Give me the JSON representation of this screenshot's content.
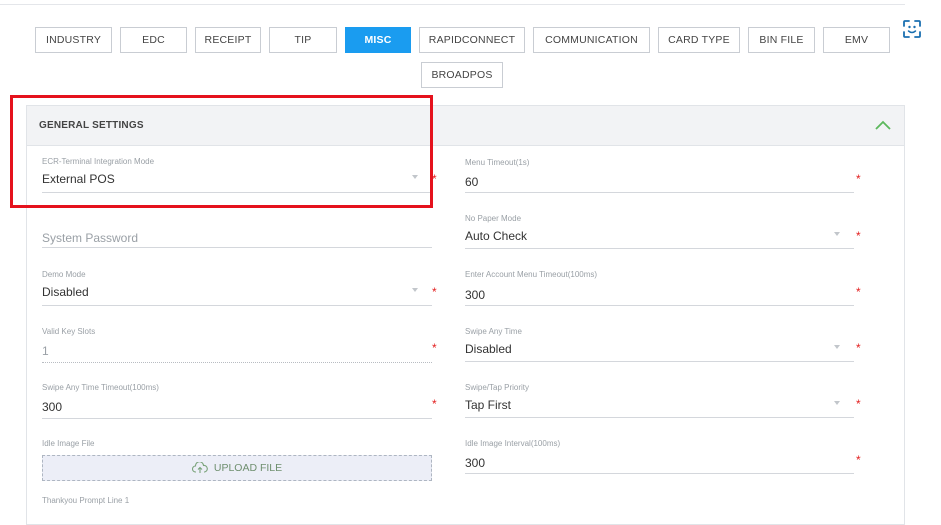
{
  "tabs": [
    {
      "label": "INDUSTRY"
    },
    {
      "label": "EDC"
    },
    {
      "label": "RECEIPT"
    },
    {
      "label": "TIP"
    },
    {
      "label": "MISC"
    },
    {
      "label": "RAPIDCONNECT"
    },
    {
      "label": "COMMUNICATION"
    },
    {
      "label": "CARD TYPE"
    },
    {
      "label": "BIN FILE"
    },
    {
      "label": "EMV"
    },
    {
      "label": "BROADPOS"
    }
  ],
  "active_tab": "MISC",
  "section": {
    "title": "GENERAL SETTINGS"
  },
  "fields": {
    "ecr_mode": {
      "label": "ECR-Terminal Integration Mode",
      "value": "External POS"
    },
    "menu_timeout": {
      "label": "Menu Timeout(1s)",
      "value": "60"
    },
    "no_paper_mode": {
      "label": "No Paper Mode",
      "value": "Auto Check"
    },
    "system_password": {
      "placeholder": "System Password"
    },
    "demo_mode": {
      "label": "Demo Mode",
      "value": "Disabled"
    },
    "enter_account_timeout": {
      "label": "Enter Account Menu Timeout(100ms)",
      "value": "300"
    },
    "valid_key_slots": {
      "label": "Valid Key Slots",
      "value": "1"
    },
    "swipe_any_time": {
      "label": "Swipe Any Time",
      "value": "Disabled"
    },
    "swipe_any_time_timeout": {
      "label": "Swipe Any Time Timeout(100ms)",
      "value": "300"
    },
    "swipe_tap_priority": {
      "label": "Swipe/Tap Priority",
      "value": "Tap First"
    },
    "idle_image_file": {
      "label": "Idle Image File",
      "button": "UPLOAD FILE"
    },
    "idle_image_interval": {
      "label": "Idle Image Interval(100ms)",
      "value": "300"
    },
    "thankyou_line1": {
      "label": "Thankyou Prompt Line 1"
    }
  },
  "required_marker": "*",
  "colors": {
    "accent": "#1a9cf0",
    "required": "#e32020",
    "highlight": "#e5121d",
    "chevron": "#5cb85c"
  }
}
